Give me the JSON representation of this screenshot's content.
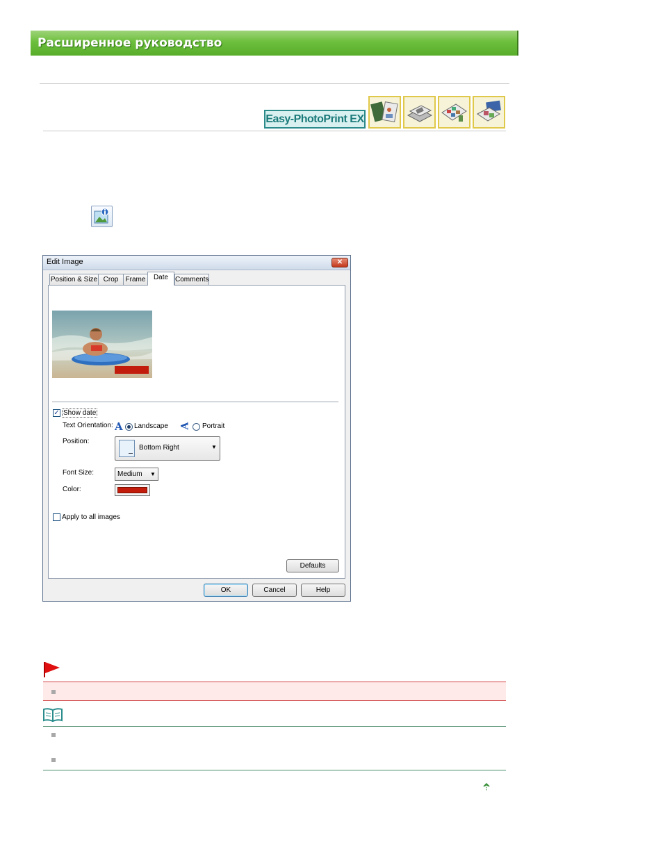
{
  "header": {
    "title": "Расширенное руководство"
  },
  "product": {
    "logo_text": "Easy-PhotoPrint EX",
    "mode_icons": [
      "album-mode-icon",
      "photo-print-mode-icon",
      "layout-print-mode-icon",
      "stickers-mode-icon"
    ]
  },
  "toolbar_icon": "edit-image-icon",
  "dialog": {
    "title": "Edit Image",
    "close_glyph": "✕",
    "tabs": [
      {
        "label": "Position & Size",
        "active": false
      },
      {
        "label": "Crop",
        "active": false
      },
      {
        "label": "Frame",
        "active": false
      },
      {
        "label": "Date",
        "active": true
      },
      {
        "label": "Comments",
        "active": false
      }
    ],
    "show_date": {
      "label": "Show date",
      "checked": true
    },
    "text_orientation": {
      "label": "Text Orientation:",
      "options": [
        {
          "label": "Landscape",
          "selected": true,
          "icon": "landscape-a-icon"
        },
        {
          "label": "Portrait",
          "selected": false,
          "icon": "portrait-a-icon"
        }
      ]
    },
    "position": {
      "label": "Position:",
      "value": "Bottom Right"
    },
    "font_size": {
      "label": "Font Size:",
      "value": "Medium"
    },
    "color": {
      "label": "Color:",
      "value": "#c21c0c"
    },
    "apply_all": {
      "label": "Apply to all images",
      "checked": false
    },
    "buttons": {
      "defaults": "Defaults",
      "ok": "OK",
      "cancel": "Cancel",
      "help": "Help"
    }
  },
  "notes": {
    "important_icon": "red-flag-icon",
    "note_icon": "open-book-icon",
    "back_to_top_icon": "up-arrow-icon"
  },
  "colors": {
    "banner_green": "#6cbf3c",
    "logo_teal": "#2b8a8a",
    "date_red": "#c21c0c"
  }
}
